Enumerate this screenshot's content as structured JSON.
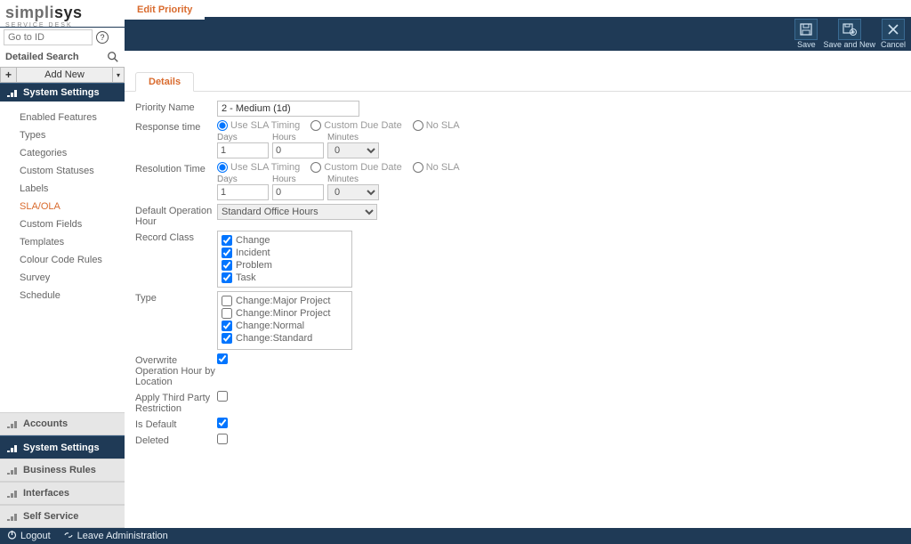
{
  "app": {
    "logo_main_1": "simpli",
    "logo_main_2": "sys",
    "logo_sub": "SERVICE DESK",
    "goto_placeholder": "Go to ID",
    "detailed_search": "Detailed Search",
    "add_new": "Add New"
  },
  "sidebar": {
    "active_section": "System Settings",
    "items": [
      {
        "label": "Enabled Features"
      },
      {
        "label": "Types"
      },
      {
        "label": "Categories"
      },
      {
        "label": "Custom Statuses"
      },
      {
        "label": "Labels"
      },
      {
        "label": "SLA/OLA"
      },
      {
        "label": "Custom Fields"
      },
      {
        "label": "Templates"
      },
      {
        "label": "Colour Code Rules"
      },
      {
        "label": "Survey"
      },
      {
        "label": "Schedule"
      }
    ],
    "bottom_sections": [
      {
        "label": "Accounts"
      },
      {
        "label": "System Settings"
      },
      {
        "label": "Business Rules"
      },
      {
        "label": "Interfaces"
      },
      {
        "label": "Self Service"
      }
    ]
  },
  "title": "Edit Priority",
  "toolbar": {
    "save": "Save",
    "save_and_new": "Save and New",
    "cancel": "Cancel"
  },
  "tabs": {
    "details": "Details"
  },
  "form": {
    "priority_name": {
      "label": "Priority Name",
      "value": "2 - Medium (1d)"
    },
    "response_time": {
      "label": "Response time"
    },
    "resolution_time": {
      "label": "Resolution Time"
    },
    "sla_option_use": "Use SLA Timing",
    "sla_option_custom": "Custom Due Date",
    "sla_option_none": "No SLA",
    "dhm": {
      "days": "Days",
      "hours": "Hours",
      "minutes": "Minutes",
      "d_val": "1",
      "h_val": "0",
      "m_val": "0"
    },
    "default_op_hour": {
      "label": "Default Operation Hour",
      "value": "Standard Office Hours"
    },
    "record_class": {
      "label": "Record Class",
      "options": [
        {
          "label": "Change",
          "checked": true
        },
        {
          "label": "Incident",
          "checked": true
        },
        {
          "label": "Problem",
          "checked": true
        },
        {
          "label": "Task",
          "checked": true
        }
      ]
    },
    "type": {
      "label": "Type",
      "options": [
        {
          "label": "Change:Major Project",
          "checked": false
        },
        {
          "label": "Change:Minor Project",
          "checked": false
        },
        {
          "label": "Change:Normal",
          "checked": true
        },
        {
          "label": "Change:Standard",
          "checked": true
        }
      ]
    },
    "overwrite_op_hour": {
      "label": "Overwrite Operation Hour by Location",
      "checked": true
    },
    "third_party": {
      "label": "Apply Third Party Restriction",
      "checked": false
    },
    "is_default": {
      "label": "Is Default",
      "checked": true
    },
    "deleted": {
      "label": "Deleted",
      "checked": false
    }
  },
  "footer": {
    "logout": "Logout",
    "leave_admin": "Leave Administration"
  }
}
